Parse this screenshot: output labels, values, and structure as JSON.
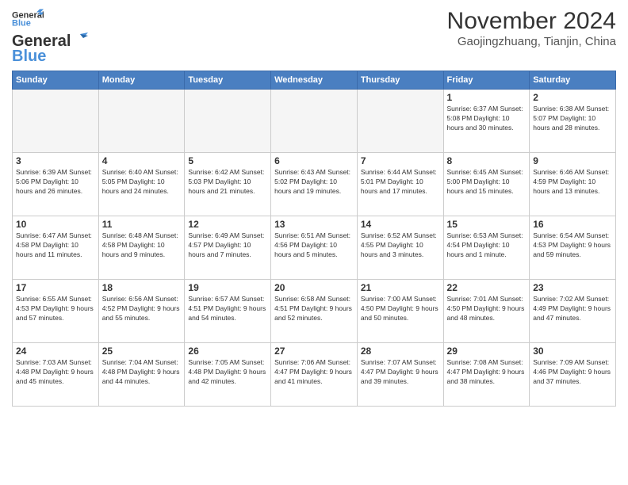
{
  "logo": {
    "line1": "General",
    "line2": "Blue"
  },
  "title": "November 2024",
  "location": "Gaojingzhuang, Tianjin, China",
  "headers": [
    "Sunday",
    "Monday",
    "Tuesday",
    "Wednesday",
    "Thursday",
    "Friday",
    "Saturday"
  ],
  "weeks": [
    [
      {
        "day": "",
        "info": "",
        "empty": true
      },
      {
        "day": "",
        "info": "",
        "empty": true
      },
      {
        "day": "",
        "info": "",
        "empty": true
      },
      {
        "day": "",
        "info": "",
        "empty": true
      },
      {
        "day": "",
        "info": "",
        "empty": true
      },
      {
        "day": "1",
        "info": "Sunrise: 6:37 AM\nSunset: 5:08 PM\nDaylight: 10 hours\nand 30 minutes."
      },
      {
        "day": "2",
        "info": "Sunrise: 6:38 AM\nSunset: 5:07 PM\nDaylight: 10 hours\nand 28 minutes."
      }
    ],
    [
      {
        "day": "3",
        "info": "Sunrise: 6:39 AM\nSunset: 5:06 PM\nDaylight: 10 hours\nand 26 minutes."
      },
      {
        "day": "4",
        "info": "Sunrise: 6:40 AM\nSunset: 5:05 PM\nDaylight: 10 hours\nand 24 minutes."
      },
      {
        "day": "5",
        "info": "Sunrise: 6:42 AM\nSunset: 5:03 PM\nDaylight: 10 hours\nand 21 minutes."
      },
      {
        "day": "6",
        "info": "Sunrise: 6:43 AM\nSunset: 5:02 PM\nDaylight: 10 hours\nand 19 minutes."
      },
      {
        "day": "7",
        "info": "Sunrise: 6:44 AM\nSunset: 5:01 PM\nDaylight: 10 hours\nand 17 minutes."
      },
      {
        "day": "8",
        "info": "Sunrise: 6:45 AM\nSunset: 5:00 PM\nDaylight: 10 hours\nand 15 minutes."
      },
      {
        "day": "9",
        "info": "Sunrise: 6:46 AM\nSunset: 4:59 PM\nDaylight: 10 hours\nand 13 minutes."
      }
    ],
    [
      {
        "day": "10",
        "info": "Sunrise: 6:47 AM\nSunset: 4:58 PM\nDaylight: 10 hours\nand 11 minutes."
      },
      {
        "day": "11",
        "info": "Sunrise: 6:48 AM\nSunset: 4:58 PM\nDaylight: 10 hours\nand 9 minutes."
      },
      {
        "day": "12",
        "info": "Sunrise: 6:49 AM\nSunset: 4:57 PM\nDaylight: 10 hours\nand 7 minutes."
      },
      {
        "day": "13",
        "info": "Sunrise: 6:51 AM\nSunset: 4:56 PM\nDaylight: 10 hours\nand 5 minutes."
      },
      {
        "day": "14",
        "info": "Sunrise: 6:52 AM\nSunset: 4:55 PM\nDaylight: 10 hours\nand 3 minutes."
      },
      {
        "day": "15",
        "info": "Sunrise: 6:53 AM\nSunset: 4:54 PM\nDaylight: 10 hours\nand 1 minute."
      },
      {
        "day": "16",
        "info": "Sunrise: 6:54 AM\nSunset: 4:53 PM\nDaylight: 9 hours\nand 59 minutes."
      }
    ],
    [
      {
        "day": "17",
        "info": "Sunrise: 6:55 AM\nSunset: 4:53 PM\nDaylight: 9 hours\nand 57 minutes."
      },
      {
        "day": "18",
        "info": "Sunrise: 6:56 AM\nSunset: 4:52 PM\nDaylight: 9 hours\nand 55 minutes."
      },
      {
        "day": "19",
        "info": "Sunrise: 6:57 AM\nSunset: 4:51 PM\nDaylight: 9 hours\nand 54 minutes."
      },
      {
        "day": "20",
        "info": "Sunrise: 6:58 AM\nSunset: 4:51 PM\nDaylight: 9 hours\nand 52 minutes."
      },
      {
        "day": "21",
        "info": "Sunrise: 7:00 AM\nSunset: 4:50 PM\nDaylight: 9 hours\nand 50 minutes."
      },
      {
        "day": "22",
        "info": "Sunrise: 7:01 AM\nSunset: 4:50 PM\nDaylight: 9 hours\nand 48 minutes."
      },
      {
        "day": "23",
        "info": "Sunrise: 7:02 AM\nSunset: 4:49 PM\nDaylight: 9 hours\nand 47 minutes."
      }
    ],
    [
      {
        "day": "24",
        "info": "Sunrise: 7:03 AM\nSunset: 4:48 PM\nDaylight: 9 hours\nand 45 minutes."
      },
      {
        "day": "25",
        "info": "Sunrise: 7:04 AM\nSunset: 4:48 PM\nDaylight: 9 hours\nand 44 minutes."
      },
      {
        "day": "26",
        "info": "Sunrise: 7:05 AM\nSunset: 4:48 PM\nDaylight: 9 hours\nand 42 minutes."
      },
      {
        "day": "27",
        "info": "Sunrise: 7:06 AM\nSunset: 4:47 PM\nDaylight: 9 hours\nand 41 minutes."
      },
      {
        "day": "28",
        "info": "Sunrise: 7:07 AM\nSunset: 4:47 PM\nDaylight: 9 hours\nand 39 minutes."
      },
      {
        "day": "29",
        "info": "Sunrise: 7:08 AM\nSunset: 4:47 PM\nDaylight: 9 hours\nand 38 minutes."
      },
      {
        "day": "30",
        "info": "Sunrise: 7:09 AM\nSunset: 4:46 PM\nDaylight: 9 hours\nand 37 minutes."
      }
    ]
  ]
}
